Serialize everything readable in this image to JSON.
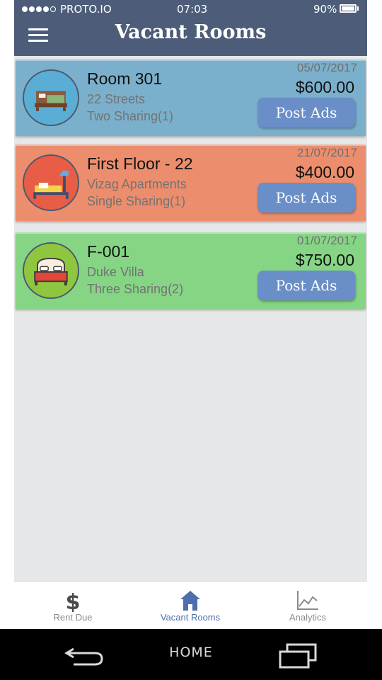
{
  "status_bar": {
    "carrier": "PROTO.IO",
    "time": "07:03",
    "battery": "90%"
  },
  "header": {
    "title": "Vacant Rooms",
    "menu_icon": "hamburger-menu-icon"
  },
  "rooms": [
    {
      "name": "Room 301",
      "place": "22 Streets",
      "sharing": "Two Sharing(1)",
      "date": "05/07/2017",
      "price": "$600.00",
      "button": "Post Ads",
      "color": "#7bb0cc",
      "icon": "bed-icon"
    },
    {
      "name": "First Floor - 22",
      "place": "Vizag Apartments",
      "sharing": "Single Sharing(1)",
      "date": "21/07/2017",
      "price": "$400.00",
      "button": "Post Ads",
      "color": "#ec8e6d",
      "icon": "bed-lamp-icon"
    },
    {
      "name": "F-001",
      "place": "Duke Villa",
      "sharing": "Three Sharing(2)",
      "date": "01/07/2017",
      "price": "$750.00",
      "button": "Post Ads",
      "color": "#86d585",
      "icon": "double-bed-icon"
    }
  ],
  "tabs": [
    {
      "label": "Rent Due",
      "icon": "dollar-icon",
      "active": false
    },
    {
      "label": "Vacant Rooms",
      "icon": "house-icon",
      "active": true
    },
    {
      "label": "Analytics",
      "icon": "line-chart-icon",
      "active": false
    }
  ],
  "system_nav": {
    "back_icon": "back-arrow-icon",
    "home_label": "HOME",
    "recent_icon": "recent-apps-icon"
  },
  "colors": {
    "header": "#4d5d79",
    "background": "#e6e7e9",
    "button": "#6a8ec7",
    "active_tab": "#4d6fae"
  }
}
